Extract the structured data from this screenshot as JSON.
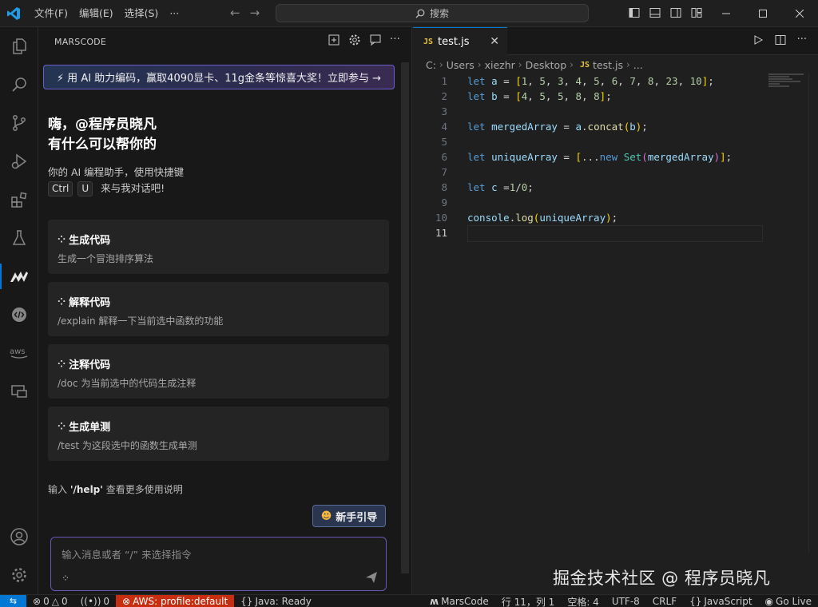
{
  "menu": {
    "file": "文件(F)",
    "edit": "编辑(E)",
    "select": "选择(S)",
    "more": "···"
  },
  "search": {
    "label": "搜索"
  },
  "panel": {
    "title": "MARSCODE",
    "banner": "⚡ 用 AI 助力编码，赢取4090显卡、11g金条等惊喜大奖！立即参与 →",
    "greeting_line1": "嗨，@程序员晓凡",
    "greeting_line2": "有什么可以帮你的",
    "assist_line": "你的 AI 编程助手，使用快捷键",
    "key_ctrl": "Ctrl",
    "key_u": "U",
    "assist_suffix": "来与我对话吧!",
    "cards": [
      {
        "title": "生成代码",
        "desc": "生成一个冒泡排序算法"
      },
      {
        "title": "解释代码",
        "desc": "/explain 解释一下当前选中函数的功能"
      },
      {
        "title": "注释代码",
        "desc": "/doc 为当前选中的代码生成注释"
      },
      {
        "title": "生成单测",
        "desc": "/test 为这段选中的函数生成单测"
      }
    ],
    "help_prefix": "输入 ",
    "help_cmd": "'/help'",
    "help_suffix": " 查看更多使用说明",
    "guide_button": "新手引导",
    "chat_placeholder": "输入消息或者 “/” 来选择指令"
  },
  "editor": {
    "tab_label": "test.js",
    "breadcrumb": [
      "C:",
      "Users",
      "xiezhr",
      "Desktop",
      "test.js",
      "..."
    ],
    "current_line": 11
  },
  "watermark": "掘金技术社区 @ 程序员晓凡",
  "status": {
    "errors": "0",
    "warnings": "0",
    "ports": "0",
    "aws": "AWS: profile:default",
    "java": "Java: Ready",
    "marscode": "MarsCode",
    "position": "行 11，列 1",
    "spaces": "空格: 4",
    "encoding": "UTF-8",
    "eol": "CRLF",
    "language": "JavaScript",
    "golive": "Go Live"
  }
}
